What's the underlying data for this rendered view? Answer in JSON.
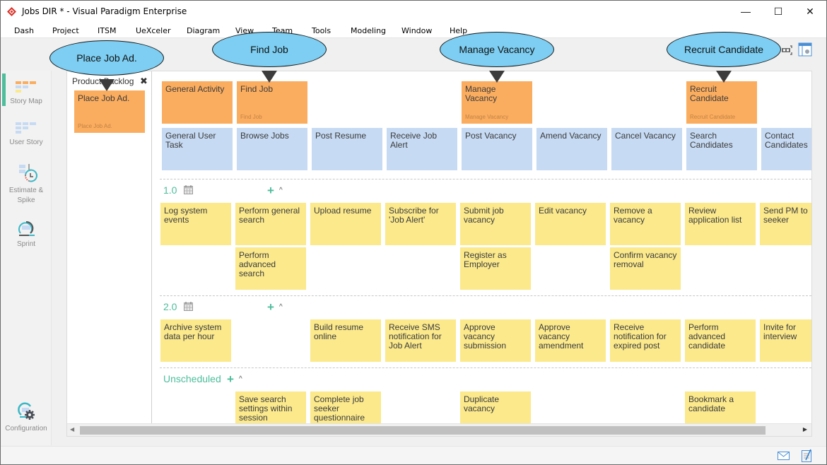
{
  "window": {
    "title": "Jobs DIR * - Visual Paradigm Enterprise",
    "minimize": "—",
    "maximize": "☐",
    "close": "✕"
  },
  "menu": [
    "Dash",
    "Project",
    "ITSM",
    "UeXceler",
    "Diagram",
    "View",
    "Team",
    "Tools",
    "Modeling",
    "Window",
    "Help"
  ],
  "nav": {
    "items": [
      {
        "label": "Story Map",
        "active": true
      },
      {
        "label": "User Story",
        "active": false
      },
      {
        "label": "Estimate &",
        "label2": "Spike",
        "active": false
      },
      {
        "label": "Sprint",
        "active": false
      },
      {
        "label": "Configuration",
        "active": false
      }
    ]
  },
  "backlog": {
    "title": "Product Backlog",
    "close": "✖",
    "cards": [
      {
        "title": "Place Job Ad.",
        "sub": "Place Job Ad."
      }
    ]
  },
  "activities": [
    {
      "title": "General Activity",
      "sub": ""
    },
    {
      "title": "Find Job",
      "sub": "Find Job"
    },
    {
      "title": "Manage Vacancy",
      "sub": "Manage Vacancy"
    },
    {
      "title": "Recruit Candidate",
      "sub": "Recruit Candidate"
    }
  ],
  "tasks": [
    "General User Task",
    "Browse Jobs",
    "Post Resume",
    "Receive Job Alert",
    "Post Vacancy",
    "Amend Vacancy",
    "Cancel Vacancy",
    "Search Candidates",
    "Contact Candidates"
  ],
  "releases": [
    {
      "name": "1.0",
      "stories": [
        [
          "Log system events"
        ],
        [
          "Perform general search",
          "Perform advanced search"
        ],
        [
          "Upload resume"
        ],
        [
          "Subscribe for 'Job Alert'"
        ],
        [
          "Submit job vacancy",
          "Register as Employer"
        ],
        [
          "Edit vacancy"
        ],
        [
          "Remove a vacancy",
          "Confirm vacancy removal"
        ],
        [
          "Review application list"
        ],
        [
          "Send PM to seeker"
        ]
      ]
    },
    {
      "name": "2.0",
      "stories": [
        [
          "Archive system data per hour"
        ],
        [],
        [
          "Build resume online"
        ],
        [
          "Receive SMS notification for Job Alert"
        ],
        [
          "Approve vacancy submission"
        ],
        [
          "Approve vacancy amendment"
        ],
        [
          "Receive notification for expired post"
        ],
        [
          "Perform advanced candidate"
        ],
        [
          "Invite for interview"
        ]
      ]
    },
    {
      "name": "Unscheduled",
      "stories": [
        [],
        [
          "Save search settings within session"
        ],
        [
          "Complete job seeker questionnaire"
        ],
        [],
        [
          "Duplicate vacancy"
        ],
        [],
        [],
        [
          "Bookmark a candidate"
        ],
        []
      ]
    }
  ],
  "callouts": [
    "Place Job Ad.",
    "Find Job",
    "Manage Vacancy",
    "Recruit Candidate"
  ],
  "colors": {
    "activity": "#fbad5f",
    "task": "#c6daf3",
    "story": "#fbe98c",
    "accent": "#4dbd9b",
    "callout": "#7dcef2"
  }
}
